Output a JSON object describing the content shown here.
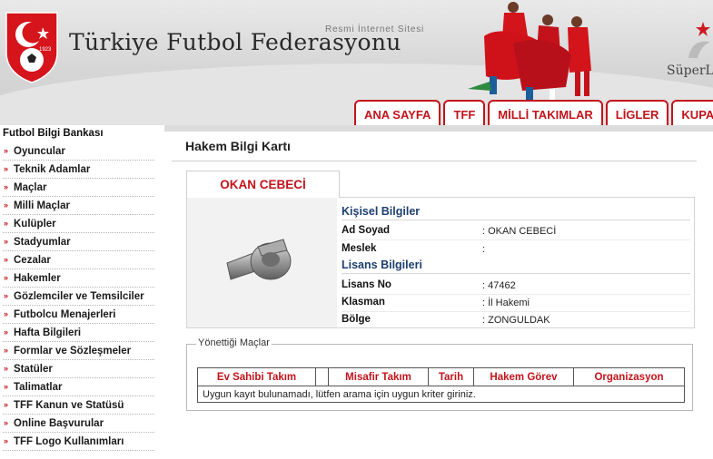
{
  "header": {
    "site_tag": "Resmi İnternet Sitesi",
    "site_title": "Türkiye Futbol Federasyonu",
    "logo_year": "1923",
    "superlig": "SüperL",
    "nav": [
      "ANA SAYFA",
      "TFF",
      "MİLLİ TAKIMLAR",
      "LİGLER",
      "KUPALA"
    ]
  },
  "sidebar": {
    "title": "Futbol Bilgi Bankası",
    "items": [
      "Oyuncular",
      "Teknik Adamlar",
      "Maçlar",
      "Milli Maçlar",
      "Kulüpler",
      "Stadyumlar",
      "Cezalar",
      "Hakemler",
      "Gözlemciler ve Temsilciler",
      "Futbolcu Menajerleri",
      "Hafta Bilgileri",
      "Formlar ve Sözleşmeler",
      "Statüler",
      "Talimatlar",
      "TFF Kanun ve Statüsü",
      "Online Başvurular",
      "TFF Logo Kullanımları"
    ]
  },
  "panel": {
    "title": "Hakem Bilgi Kartı",
    "referee_name": "OKAN CEBECİ",
    "personal": {
      "heading": "Kişisel Bilgiler",
      "rows": [
        {
          "label": "Ad Soyad",
          "value": ": OKAN CEBECİ"
        },
        {
          "label": "Meslek",
          "value": ":"
        }
      ]
    },
    "license": {
      "heading": "Lisans Bilgileri",
      "rows": [
        {
          "label": "Lisans No",
          "value": ": 47462"
        },
        {
          "label": "Klasman",
          "value": ": İl Hakemi"
        },
        {
          "label": "Bölge",
          "value": ": ZONGULDAK"
        }
      ]
    },
    "matches": {
      "legend": "Yönettiği Maçlar",
      "columns": [
        "Ev Sahibi Takım",
        "",
        "Misafir Takım",
        "Tarih",
        "Hakem Görev",
        "Organizasyon"
      ],
      "empty_message": "Uygun kayıt bulunamadı, lütfen arama için uygun kriter giriniz."
    }
  },
  "colors": {
    "accent": "#c3131b",
    "section_heading": "#1d3f6e",
    "header_bg": "#d6d6d6"
  }
}
